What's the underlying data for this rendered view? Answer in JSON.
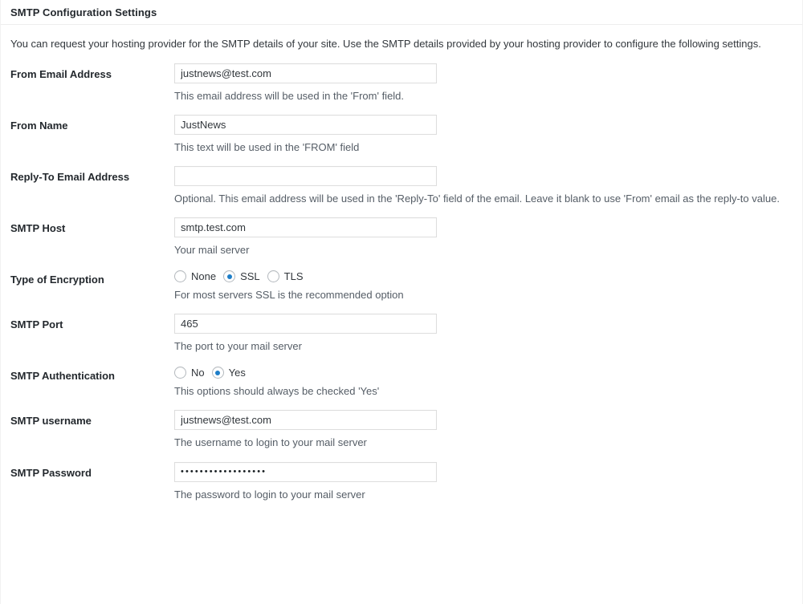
{
  "panel": {
    "title": "SMTP Configuration Settings",
    "intro": "You can request your hosting provider for the SMTP details of your site. Use the SMTP details provided by your hosting provider to configure the following settings."
  },
  "colors": {
    "accent": "#1e7ec8",
    "border": "#dddddd",
    "text": "#23282d",
    "description": "#555d66"
  },
  "fields": {
    "from_email": {
      "label": "From Email Address",
      "value": "justnews@test.com",
      "placeholder": "",
      "description": "This email address will be used in the 'From' field."
    },
    "from_name": {
      "label": "From Name",
      "value": "JustNews",
      "placeholder": "",
      "description": "This text will be used in the 'FROM' field"
    },
    "reply_to": {
      "label": "Reply-To Email Address",
      "value": "",
      "placeholder": "",
      "description": "Optional. This email address will be used in the 'Reply-To' field of the email. Leave it blank to use 'From' email as the reply-to value."
    },
    "smtp_host": {
      "label": "SMTP Host",
      "value": "smtp.test.com",
      "placeholder": "",
      "description": "Your mail server"
    },
    "encryption": {
      "label": "Type of Encryption",
      "description": "For most servers SSL is the recommended option",
      "selected": "SSL",
      "options": [
        {
          "label": "None",
          "checked": false
        },
        {
          "label": "SSL",
          "checked": true
        },
        {
          "label": "TLS",
          "checked": false
        }
      ]
    },
    "smtp_port": {
      "label": "SMTP Port",
      "value": "465",
      "placeholder": "",
      "description": "The port to your mail server"
    },
    "smtp_auth": {
      "label": "SMTP Authentication",
      "description": "This options should always be checked 'Yes'",
      "selected": "Yes",
      "options": [
        {
          "label": "No",
          "checked": false
        },
        {
          "label": "Yes",
          "checked": true
        }
      ]
    },
    "smtp_username": {
      "label": "SMTP username",
      "value": "justnews@test.com",
      "placeholder": "",
      "description": "The username to login to your mail server"
    },
    "smtp_password": {
      "label": "SMTP Password",
      "value": "••••••••••••••••••",
      "placeholder": "",
      "description": "The password to login to your mail server"
    }
  }
}
